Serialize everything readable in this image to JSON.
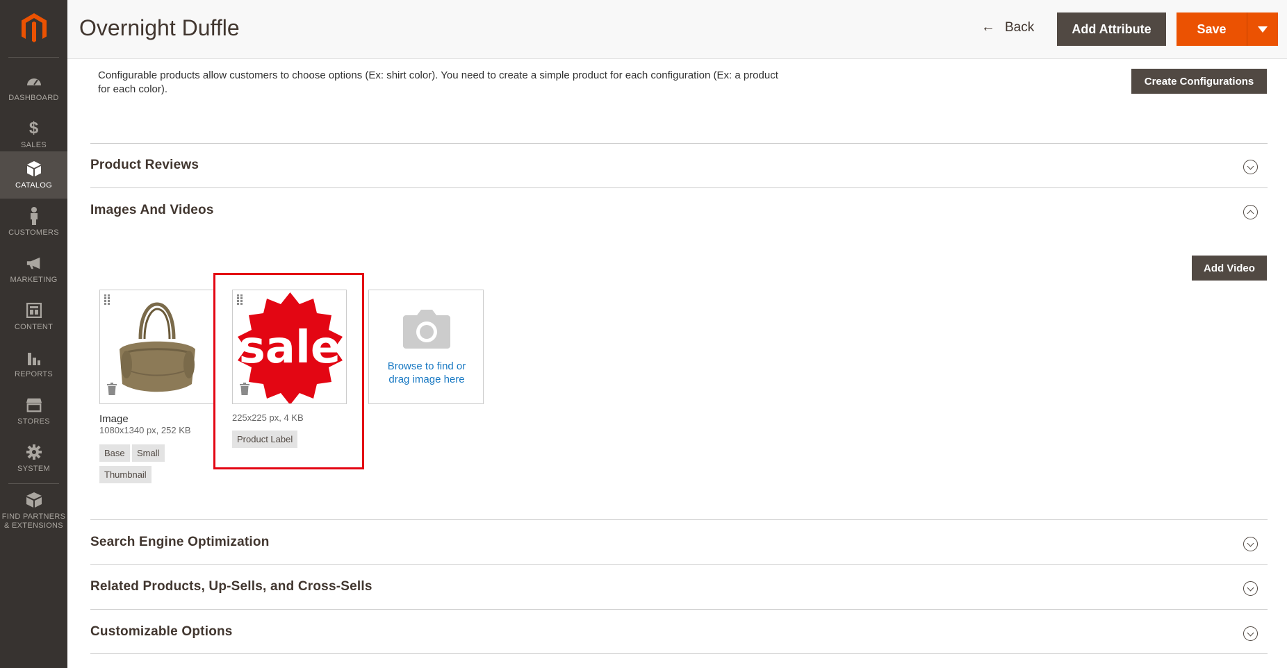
{
  "sidebar": {
    "items": [
      {
        "label": "DASHBOARD",
        "icon": "dashboard-icon"
      },
      {
        "label": "SALES",
        "icon": "dollar-icon"
      },
      {
        "label": "CATALOG",
        "icon": "catalog-box-icon"
      },
      {
        "label": "CUSTOMERS",
        "icon": "customer-person-icon"
      },
      {
        "label": "MARKETING",
        "icon": "megaphone-icon"
      },
      {
        "label": "CONTENT",
        "icon": "content-layout-icon"
      },
      {
        "label": "REPORTS",
        "icon": "bar-chart-icon"
      },
      {
        "label": "STORES",
        "icon": "store-icon"
      },
      {
        "label": "SYSTEM",
        "icon": "gear-icon"
      },
      {
        "label_line1": "FIND PARTNERS",
        "label_line2": "& EXTENSIONS",
        "icon": "extensions-box-icon"
      }
    ],
    "active": "CATALOG"
  },
  "header": {
    "title": "Overnight Duffle",
    "back_label": "Back",
    "add_attribute_label": "Add Attribute",
    "save_label": "Save"
  },
  "configurations": {
    "description": "Configurable products allow customers to choose options (Ex: shirt color). You need to create a simple product for each configuration (Ex: a product for each color).",
    "create_button": "Create Configurations"
  },
  "sections": {
    "product_reviews": "Product Reviews",
    "images_and_videos": "Images And Videos",
    "seo": "Search Engine Optimization",
    "related": "Related Products, Up-Sells, and Cross-Sells",
    "customizable": "Customizable Options"
  },
  "images": {
    "add_video_label": "Add Video",
    "items": [
      {
        "name": "Image",
        "meta": "1080x1340 px, 252 KB",
        "roles": [
          "Base",
          "Small",
          "Thumbnail"
        ]
      },
      {
        "name": "",
        "meta": "225x225 px, 4 KB",
        "roles": [
          "Product Label"
        ],
        "sale_text": "sale"
      }
    ],
    "upload": {
      "line1": "Browse to find or",
      "line2": "drag image here"
    }
  },
  "colors": {
    "accent": "#eb5202",
    "sidebar": "#373330",
    "dark_button": "#514943",
    "highlight": "#e30613",
    "link": "#1979c3"
  }
}
